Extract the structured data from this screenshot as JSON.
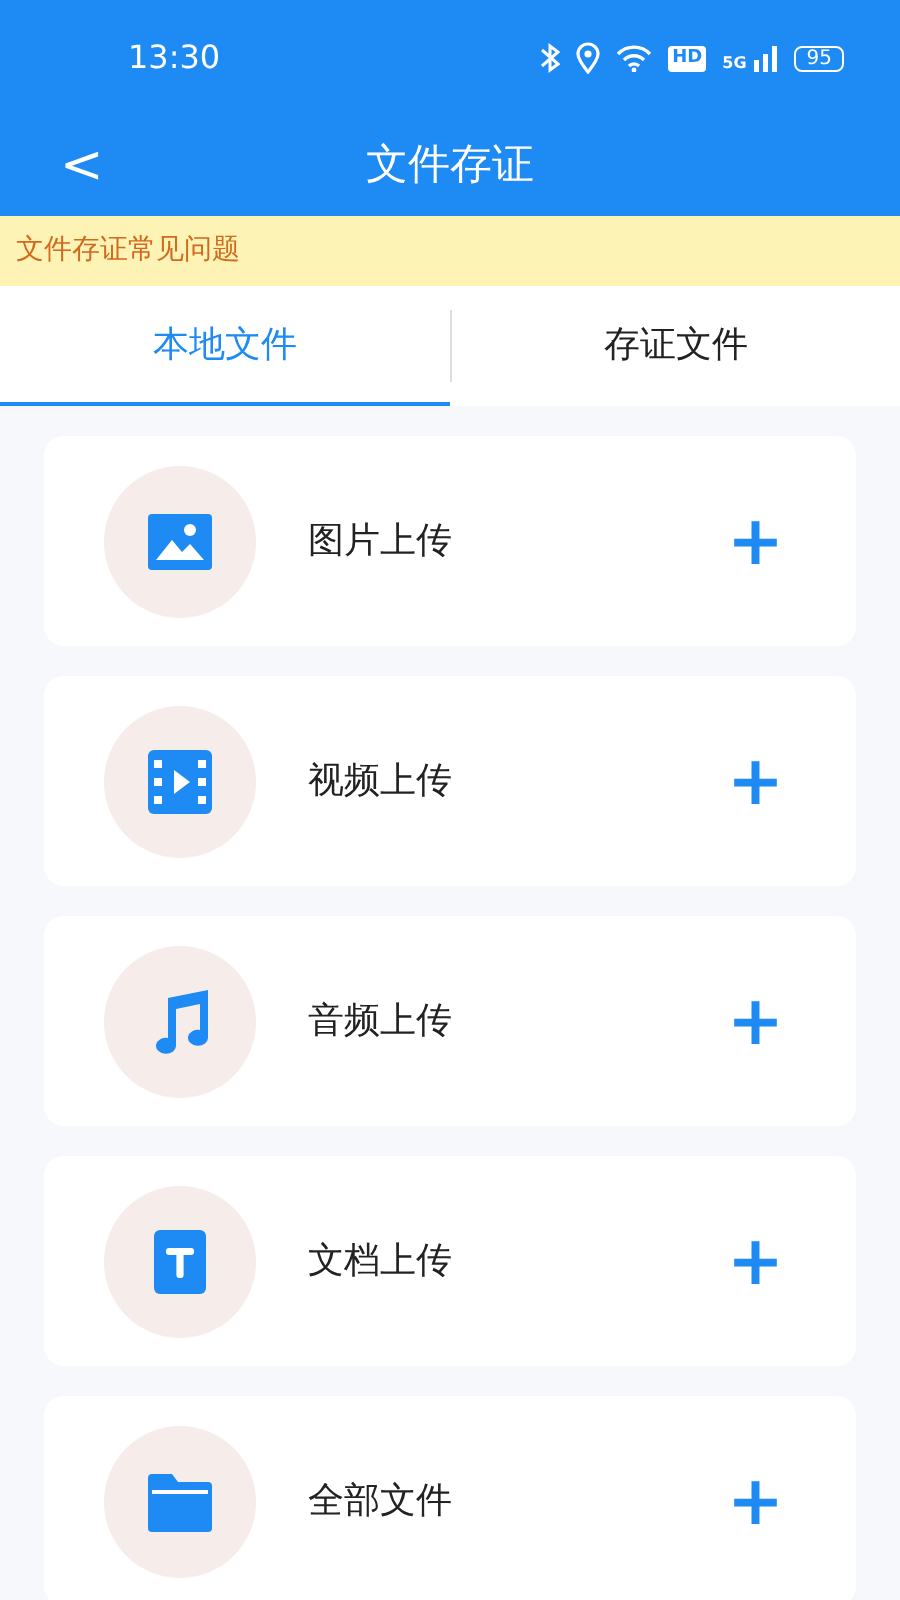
{
  "status_bar": {
    "time": "13:30",
    "hd": "HD",
    "network": "5G",
    "battery": "95"
  },
  "app_bar": {
    "back": "<",
    "title": "文件存证"
  },
  "notice": "文件存证常见问题",
  "tabs": [
    {
      "label": "本地文件",
      "selected": true
    },
    {
      "label": "存证文件",
      "selected": false
    }
  ],
  "items": [
    {
      "kind": "image",
      "label": "图片上传",
      "action": "+"
    },
    {
      "kind": "video",
      "label": "视频上传",
      "action": "+"
    },
    {
      "kind": "audio",
      "label": "音频上传",
      "action": "+"
    },
    {
      "kind": "document",
      "label": "文档上传",
      "action": "+"
    },
    {
      "kind": "folder",
      "label": "全部文件",
      "action": "+"
    }
  ]
}
